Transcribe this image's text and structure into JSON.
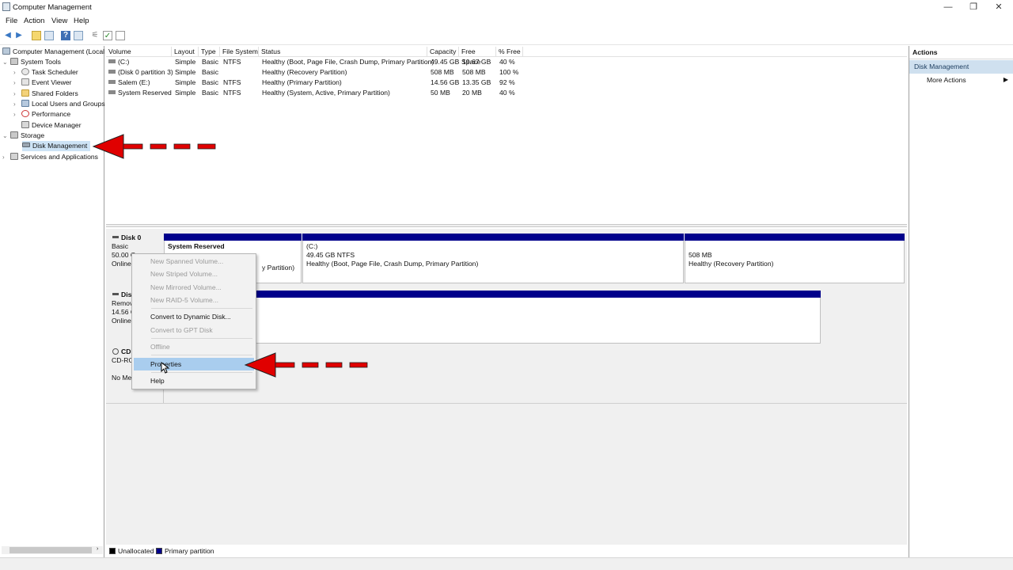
{
  "window": {
    "title": "Computer Management",
    "minimize_glyph": "—",
    "restore_glyph": "❐",
    "close_glyph": "✕"
  },
  "menu": [
    "File",
    "Action",
    "View",
    "Help"
  ],
  "tree": [
    {
      "label": "Computer Management (Local",
      "icon": "computer-icon"
    },
    {
      "label": "System Tools",
      "icon": "tools-icon"
    },
    {
      "label": "Task Scheduler",
      "icon": "clock-icon"
    },
    {
      "label": "Event Viewer",
      "icon": "event-viewer-icon"
    },
    {
      "label": "Shared Folders",
      "icon": "folder-icon"
    },
    {
      "label": "Local Users and Groups",
      "icon": "users-icon"
    },
    {
      "label": "Performance",
      "icon": "performance-icon"
    },
    {
      "label": "Device Manager",
      "icon": "device-icon"
    },
    {
      "label": "Storage",
      "icon": "storage-icon"
    },
    {
      "label": "Disk Management",
      "icon": "disk-icon"
    },
    {
      "label": "Services and Applications",
      "icon": "services-icon"
    }
  ],
  "volume_table": {
    "headers": [
      "Volume",
      "Layout",
      "Type",
      "File System",
      "Status",
      "Capacity",
      "Free Space",
      "% Free"
    ],
    "rows": [
      [
        "(C:)",
        "Simple",
        "Basic",
        "NTFS",
        "Healthy (Boot, Page File, Crash Dump, Primary Partition)",
        "49.45 GB",
        "19.67 GB",
        "40 %"
      ],
      [
        "(Disk 0 partition 3)",
        "Simple",
        "Basic",
        "",
        "Healthy (Recovery Partition)",
        "508 MB",
        "508 MB",
        "100 %"
      ],
      [
        "Salem (E:)",
        "Simple",
        "Basic",
        "NTFS",
        "Healthy (Primary Partition)",
        "14.56 GB",
        "13.35 GB",
        "92 %"
      ],
      [
        "System Reserved",
        "Simple",
        "Basic",
        "NTFS",
        "Healthy (System, Active, Primary Partition)",
        "50 MB",
        "20 MB",
        "40 %"
      ]
    ]
  },
  "disks": {
    "disk0": {
      "name": "Disk 0",
      "type": "Basic",
      "size": "50.00 G",
      "status": "Online"
    },
    "disk1": {
      "name": "Dis",
      "type": "Remov",
      "size": "14.56 G",
      "status": "Online"
    },
    "cdrom": {
      "name": "CD",
      "type": "CD-RO",
      "status": "No Me"
    }
  },
  "partitions": {
    "system_reserved": {
      "title": "System Reserved",
      "status": "y Partition)"
    },
    "c": {
      "title": "(C:)",
      "size": "49.45 GB NTFS",
      "status": "Healthy (Boot, Page File, Crash Dump, Primary Partition)"
    },
    "recovery": {
      "size": "508 MB",
      "status": "Healthy (Recovery Partition)"
    }
  },
  "legend": [
    "Unallocated",
    "Primary partition"
  ],
  "actions": {
    "title": "Actions",
    "section": "Disk Management",
    "more": "More Actions"
  },
  "context_menu": [
    {
      "label": "New Spanned Volume...",
      "enabled": false
    },
    {
      "label": "New Striped Volume...",
      "enabled": false
    },
    {
      "label": "New Mirrored Volume...",
      "enabled": false
    },
    {
      "label": "New RAID-5 Volume...",
      "enabled": false
    },
    {
      "label": "Convert to Dynamic Disk...",
      "enabled": true
    },
    {
      "label": "Convert to GPT Disk",
      "enabled": false
    },
    {
      "label": "Offline",
      "enabled": false
    },
    {
      "label": "Properties",
      "enabled": true,
      "highlighted": true
    },
    {
      "label": "Help",
      "enabled": true
    }
  ],
  "colors": {
    "primary_partition": "#00008b",
    "annotation_arrow": "#e00000",
    "selection": "#cde3f5"
  }
}
